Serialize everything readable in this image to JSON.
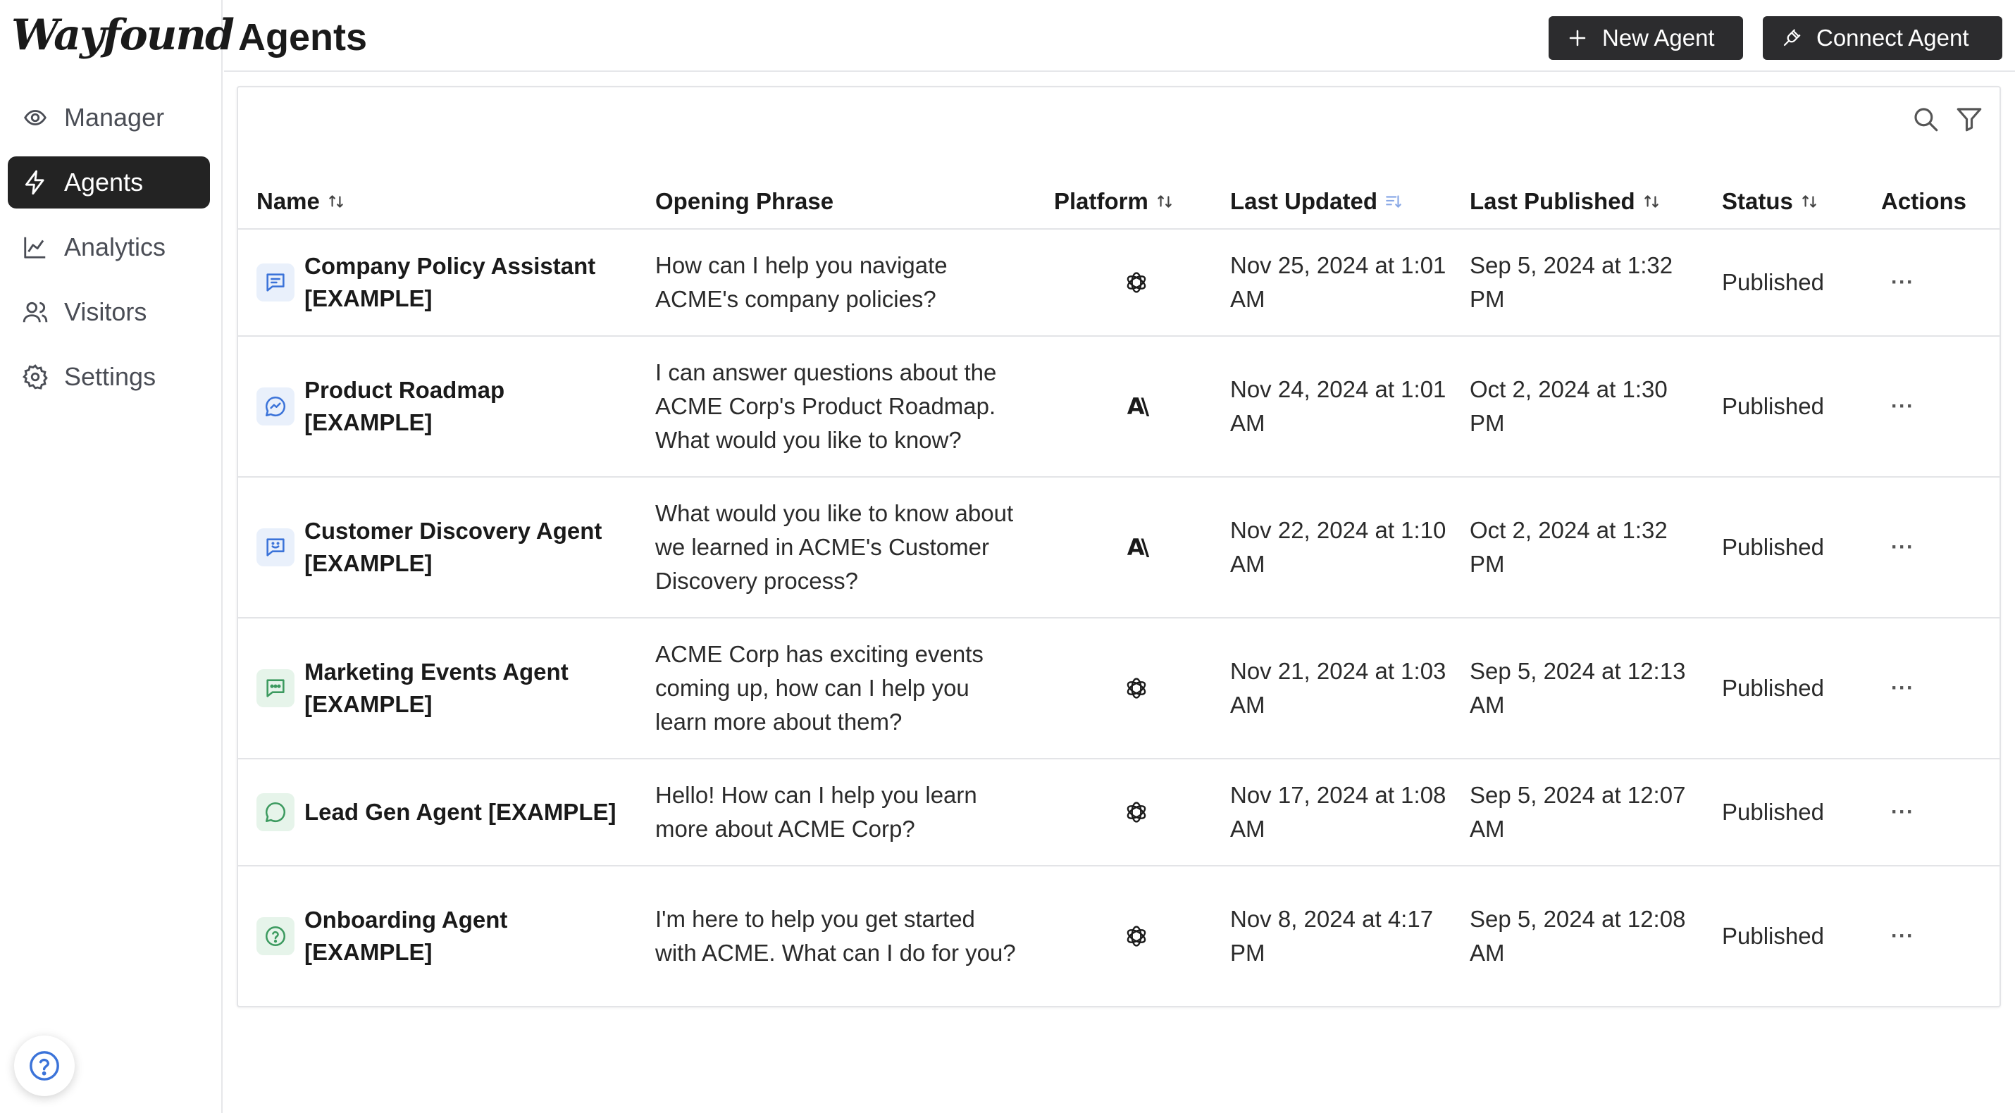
{
  "app": {
    "logo": "Wayfound"
  },
  "sidebar": {
    "items": [
      {
        "label": "Manager",
        "icon": "eye-target-icon",
        "active": false
      },
      {
        "label": "Agents",
        "icon": "lightning-icon",
        "active": true
      },
      {
        "label": "Analytics",
        "icon": "chart-icon",
        "active": false
      },
      {
        "label": "Visitors",
        "icon": "users-icon",
        "active": false
      },
      {
        "label": "Settings",
        "icon": "gear-icon",
        "active": false
      }
    ],
    "help_icon": "help-circle-icon"
  },
  "header": {
    "title": "Agents",
    "new_agent_label": "New Agent",
    "connect_agent_label": "Connect Agent"
  },
  "table": {
    "columns": {
      "name": "Name",
      "opening_phrase": "Opening Phrase",
      "platform": "Platform",
      "last_updated": "Last Updated",
      "last_published": "Last Published",
      "status": "Status",
      "actions": "Actions"
    },
    "rows": [
      {
        "name": "Company Policy Assistant [EXAMPLE]",
        "icon": "chat-lines-icon",
        "phrase": "How can I help you navigate ACME's company policies?",
        "platform": "openai-icon",
        "platform_text": "",
        "updated": "Nov 25, 2024 at 1:01 AM",
        "published": "Sep 5, 2024 at 1:32 PM",
        "status": "Published",
        "actions": "···"
      },
      {
        "name": "Product Roadmap [EXAMPLE]",
        "icon": "messenger-bolt-icon",
        "phrase": "I can answer questions about the ACME Corp's Product Roadmap. What would you like to know?",
        "platform": "anthropic-icon",
        "platform_text": "A\\",
        "updated": "Nov 24, 2024 at 1:01 AM",
        "published": "Oct 2, 2024 at 1:30 PM",
        "status": "Published",
        "actions": "···"
      },
      {
        "name": "Customer Discovery Agent [EXAMPLE]",
        "icon": "chat-smile-icon",
        "phrase": "What would you like to know about we learned in ACME's Customer Discovery process?",
        "platform": "anthropic-icon",
        "platform_text": "A\\",
        "updated": "Nov 22, 2024 at 1:10 AM",
        "published": "Oct 2, 2024 at 1:32 PM",
        "status": "Published",
        "actions": "···"
      },
      {
        "name": "Marketing Events Agent [EXAMPLE]",
        "icon": "chat-dots-icon",
        "phrase": "ACME Corp has exciting events coming up, how can I help you learn more about them?",
        "platform": "openai-icon",
        "platform_text": "",
        "updated": "Nov 21, 2024 at 1:03 AM",
        "published": "Sep 5, 2024 at 12:13 AM",
        "status": "Published",
        "actions": "···"
      },
      {
        "name": "Lead Gen Agent [EXAMPLE]",
        "icon": "chat-round-icon",
        "phrase": "Hello! How can I help you learn more about ACME Corp?",
        "platform": "openai-icon",
        "platform_text": "",
        "updated": "Nov 17, 2024 at 1:08 AM",
        "published": "Sep 5, 2024 at 12:07 AM",
        "status": "Published",
        "actions": "···"
      },
      {
        "name": "Onboarding Agent [EXAMPLE]",
        "icon": "question-circle-icon",
        "phrase": "I'm here to help you get started with ACME. What can I do for you?",
        "platform": "openai-icon",
        "platform_text": "",
        "updated": "Nov 8, 2024 at 4:17 PM",
        "published": "Sep 5, 2024 at 12:08 AM",
        "status": "Published",
        "actions": "···"
      }
    ]
  },
  "colors": {
    "active_nav_bg": "#232323",
    "button_bg": "#2c2c2e",
    "border": "#e3e4e7",
    "icon_blue": "#3b73d9",
    "icon_green": "#3c9a5f"
  }
}
